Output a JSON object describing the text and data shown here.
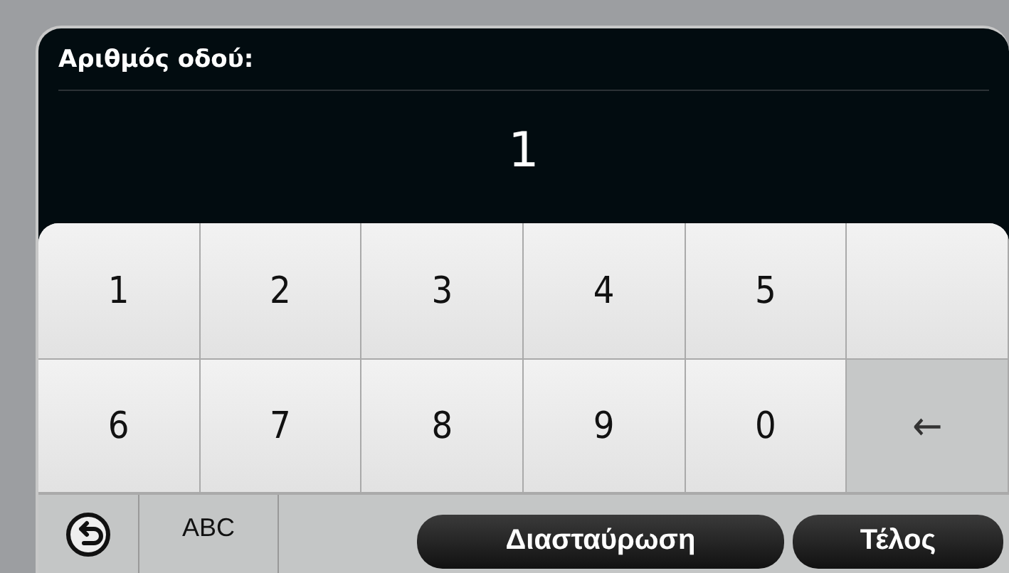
{
  "field": {
    "label": "Αριθμός οδού:",
    "value": "1"
  },
  "keys": [
    {
      "kind": "digit",
      "label": "1"
    },
    {
      "kind": "digit",
      "label": "2"
    },
    {
      "kind": "digit",
      "label": "3"
    },
    {
      "kind": "digit",
      "label": "4"
    },
    {
      "kind": "digit",
      "label": "5"
    },
    {
      "kind": "blank"
    },
    {
      "kind": "digit",
      "label": "6"
    },
    {
      "kind": "digit",
      "label": "7"
    },
    {
      "kind": "digit",
      "label": "8"
    },
    {
      "kind": "digit",
      "label": "9"
    },
    {
      "kind": "digit",
      "label": "0"
    },
    {
      "kind": "backspace",
      "label": "←"
    }
  ],
  "bottom_bar": {
    "mode_key": "ABC",
    "buttons": [
      "Διασταύρωση",
      "Τέλος"
    ]
  }
}
